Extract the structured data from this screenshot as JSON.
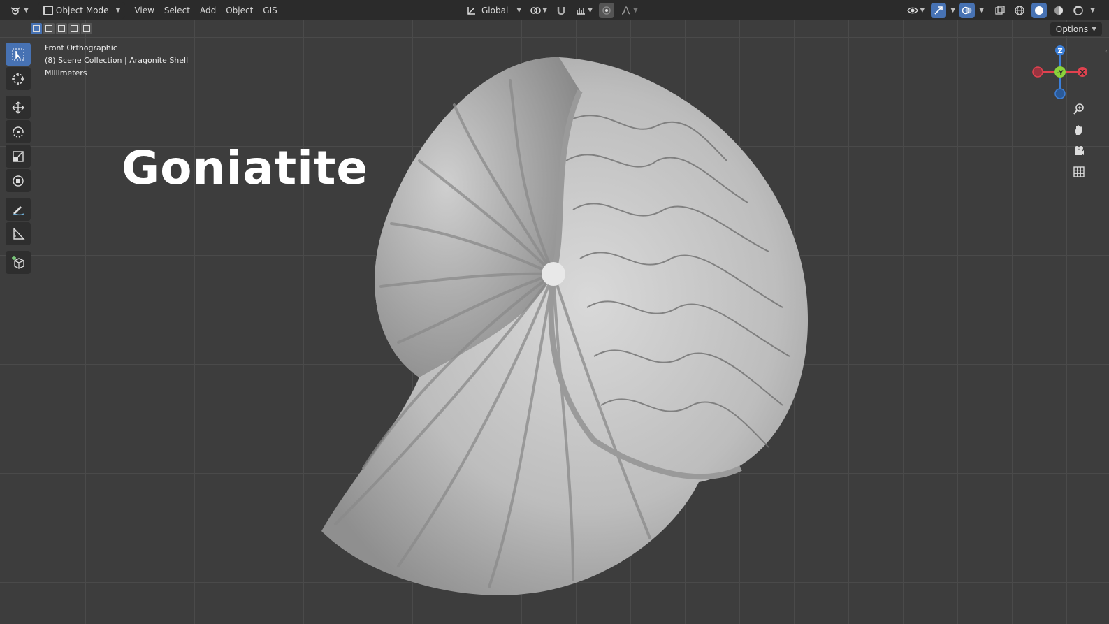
{
  "header": {
    "mode": "Object Mode",
    "menus": [
      "View",
      "Select",
      "Add",
      "Object",
      "GIS"
    ],
    "transform_orientation": "Global"
  },
  "subheader": {
    "options_label": "Options"
  },
  "viewport": {
    "view_name": "Front Orthographic",
    "collection": "(8) Scene Collection | Aragonite Shell",
    "units": "Millimeters",
    "overlay_title": "Goniatite"
  },
  "gizmo": {
    "z_label": "Z",
    "y_label": "-Y",
    "x_label": "X"
  },
  "colors": {
    "accent": "#4772b3",
    "axis_x": "#e0424f",
    "axis_y": "#8bd23b",
    "axis_z": "#3c7fd8"
  }
}
